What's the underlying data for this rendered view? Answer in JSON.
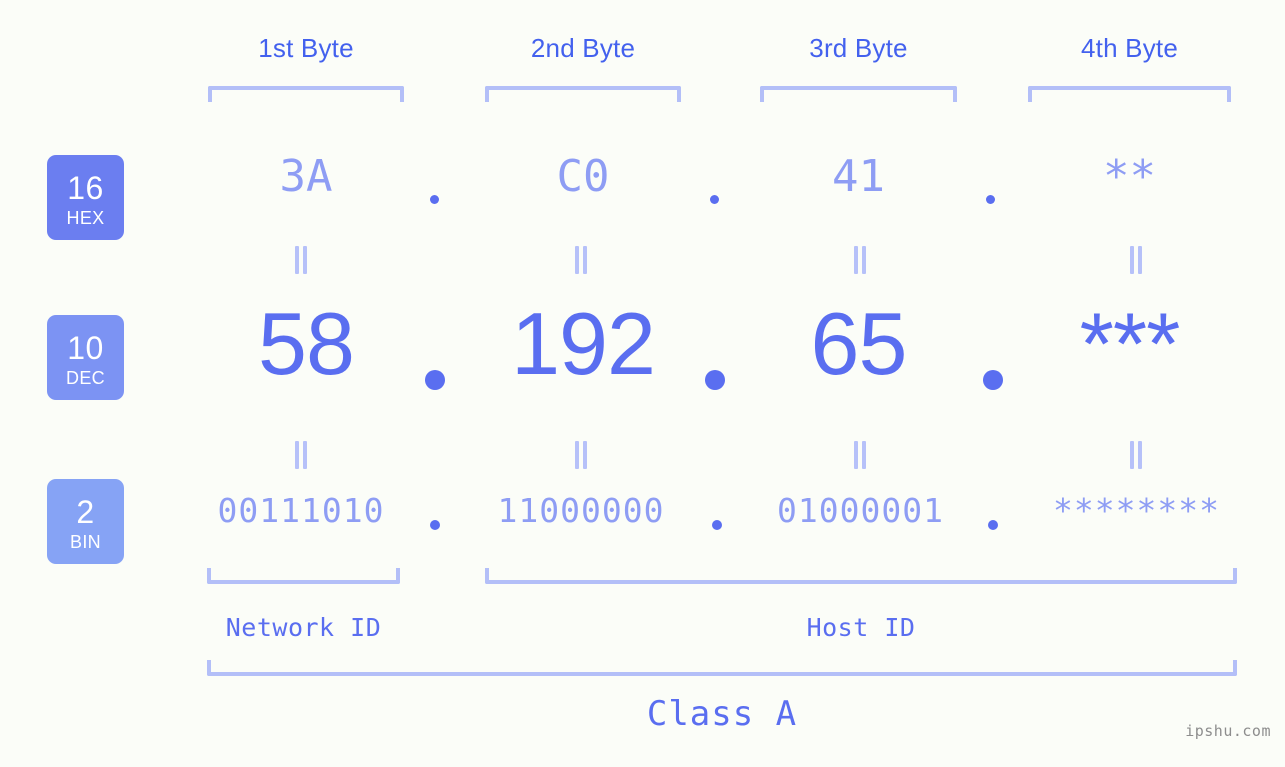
{
  "page": {
    "background_color": "#fbfdf8",
    "accent_dark": "#4361ee",
    "accent_mid": "#5a6ef0",
    "accent_light": "#8e9df4",
    "accent_pale": "#b3bff8",
    "watermark": "ipshu.com"
  },
  "columns": [
    {
      "label": "1st Byte"
    },
    {
      "label": "2nd Byte"
    },
    {
      "label": "3rd Byte"
    },
    {
      "label": "4th Byte"
    }
  ],
  "rows": {
    "hex": {
      "badge_number": "16",
      "badge_name": "HEX",
      "badge_color": "#6b7ef0",
      "values": [
        "3A",
        "C0",
        "41",
        "**"
      ],
      "separator": "."
    },
    "dec": {
      "badge_number": "10",
      "badge_name": "DEC",
      "badge_color": "#7c93f3",
      "values": [
        "58",
        "192",
        "65",
        "***"
      ],
      "separator": "."
    },
    "bin": {
      "badge_number": "2",
      "badge_name": "BIN",
      "badge_color": "#86a3f5",
      "values": [
        "00111010",
        "11000000",
        "01000001",
        "********"
      ],
      "separator": "."
    }
  },
  "equality_marker": "=",
  "segments": {
    "network_id": "Network ID",
    "host_id": "Host ID"
  },
  "class": {
    "label": "Class A"
  }
}
